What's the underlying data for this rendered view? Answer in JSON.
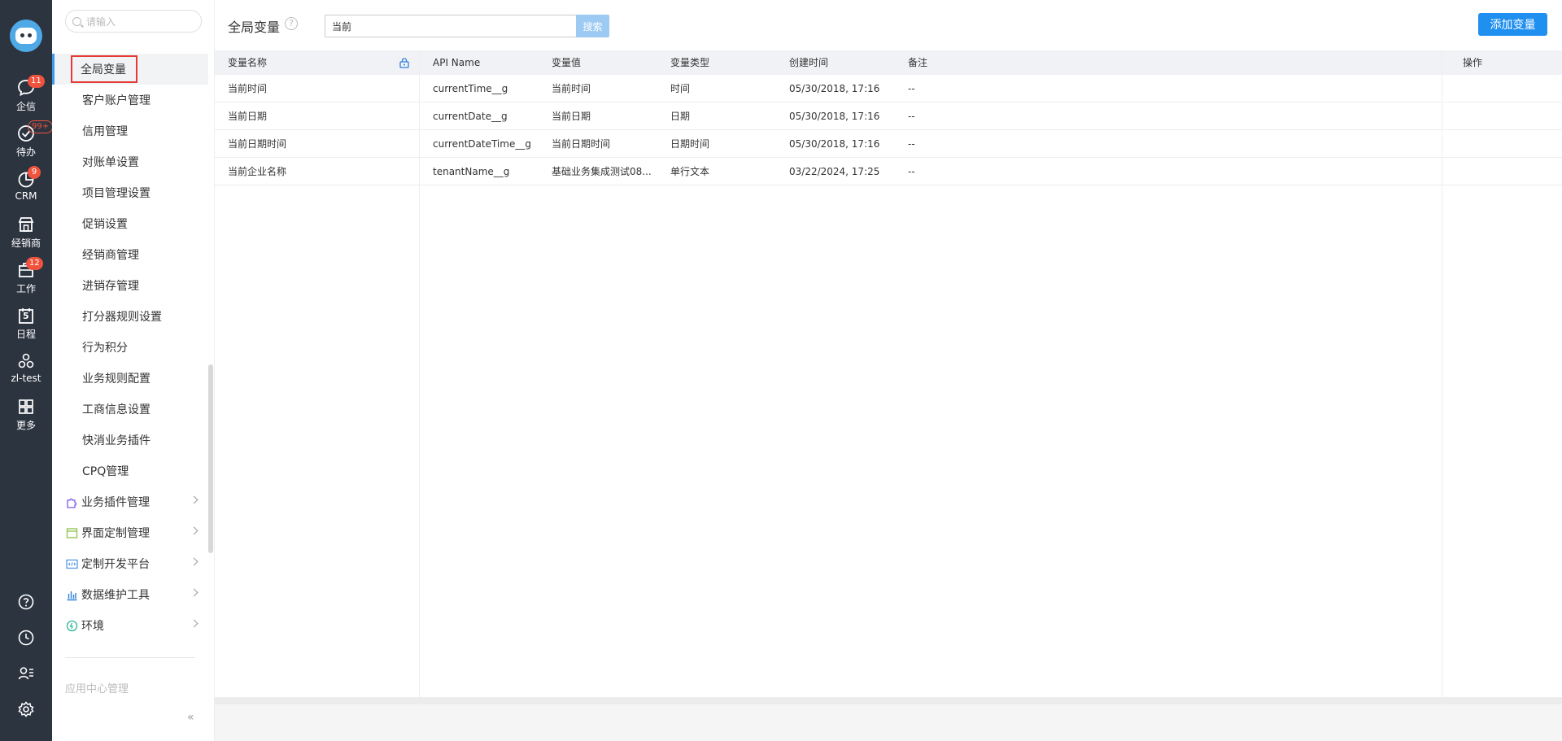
{
  "rail": {
    "items": [
      {
        "label": "企信",
        "badge": "11"
      },
      {
        "label": "待办",
        "badge": "99+"
      },
      {
        "label": "CRM",
        "badge": "9"
      },
      {
        "label": "经销商",
        "badge": ""
      },
      {
        "label": "工作",
        "badge": "12"
      },
      {
        "label": "日程",
        "badge": "",
        "icon_text": "5"
      },
      {
        "label": "zl-test",
        "badge": ""
      },
      {
        "label": "更多",
        "badge": ""
      }
    ]
  },
  "sidebar": {
    "search_placeholder": "请输入",
    "items": [
      {
        "label": "全局变量"
      },
      {
        "label": "客户账户管理"
      },
      {
        "label": "信用管理"
      },
      {
        "label": "对账单设置"
      },
      {
        "label": "项目管理设置"
      },
      {
        "label": "促销设置"
      },
      {
        "label": "经销商管理"
      },
      {
        "label": "进销存管理"
      },
      {
        "label": "打分器规则设置"
      },
      {
        "label": "行为积分"
      },
      {
        "label": "业务规则配置"
      },
      {
        "label": "工商信息设置"
      },
      {
        "label": "快消业务插件"
      },
      {
        "label": "CPQ管理"
      }
    ],
    "groups": [
      {
        "label": "业务插件管理"
      },
      {
        "label": "界面定制管理"
      },
      {
        "label": "定制开发平台"
      },
      {
        "label": "数据维护工具"
      },
      {
        "label": "环境"
      }
    ],
    "footer_label": "应用中心管理",
    "collapse_glyph": "«"
  },
  "main": {
    "title": "全局变量",
    "help_glyph": "?",
    "search_value": "当前",
    "search_button": "搜索",
    "add_button": "添加变量",
    "columns": [
      "变量名称",
      "API Name",
      "变量值",
      "变量类型",
      "创建时间",
      "备注",
      "操作"
    ],
    "rows": [
      [
        "当前时间",
        "currentTime__g",
        "当前时间",
        "时间",
        "05/30/2018, 17:16",
        "--",
        ""
      ],
      [
        "当前日期",
        "currentDate__g",
        "当前日期",
        "日期",
        "05/30/2018, 17:16",
        "--",
        ""
      ],
      [
        "当前日期时间",
        "currentDateTime__g",
        "当前日期时间",
        "日期时间",
        "05/30/2018, 17:16",
        "--",
        ""
      ],
      [
        "当前企业名称",
        "tenantName__g",
        "基础业务集成测试08...",
        "单行文本",
        "03/22/2024, 17:25",
        "--",
        ""
      ]
    ]
  },
  "colors": {
    "rail_bg": "#2c3440",
    "accent": "#1f8ff0",
    "badge": "#f0533d",
    "highlight_box": "#e53935"
  }
}
